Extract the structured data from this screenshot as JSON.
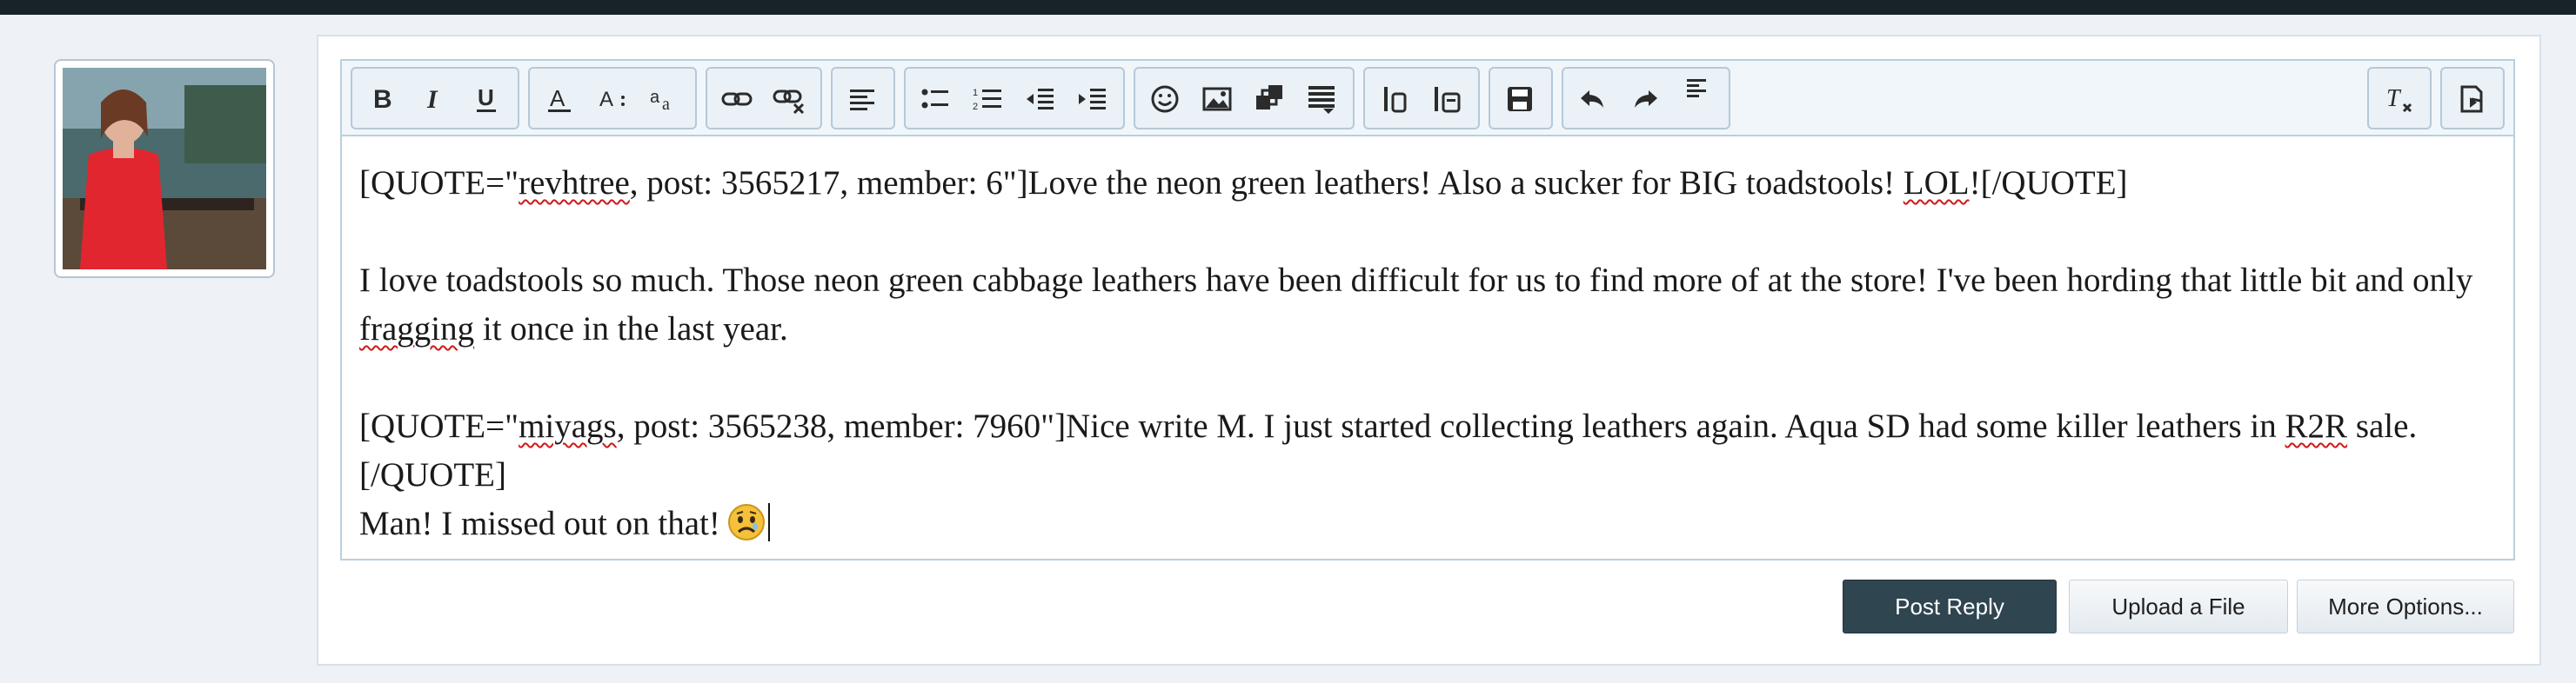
{
  "icons": {
    "bold": "bold-icon",
    "italic": "italic-icon",
    "underline": "underline-icon",
    "font_color": "font-color-icon",
    "font_size": "font-size-icon",
    "font_family": "font-family-icon",
    "link": "link-icon",
    "unlink": "unlink-icon",
    "align": "align-left-icon",
    "bullets": "bulleted-list-icon",
    "numbers": "numbered-list-icon",
    "outdent": "outdent-icon",
    "indent": "indent-icon",
    "smilies": "smilie-icon",
    "image": "image-icon",
    "media": "media-icon",
    "quote": "insert-quote-icon",
    "table1": "table-icon",
    "table2": "code-icon",
    "drafts": "save-draft-icon",
    "undo": "undo-icon",
    "redo": "redo-icon",
    "more": "more-options-icon",
    "remove_format": "remove-format-icon",
    "toggle_bbcode": "toggle-bbcode-icon"
  },
  "editor": {
    "line1_pre": "[QUOTE=\"",
    "line1_user": "revhtree",
    "line1_post": ", post: 3565217, member: 6\"]Love the neon green leathers! Also a sucker for BIG toadstools! ",
    "line1_lol": "LOL",
    "line1_end": "![/QUOTE]",
    "line2_pre": "I love toadstools so much. Those neon green cabbage leathers have been difficult for us to find more of at the store! I've been hording that little bit and only ",
    "line2_word": "fragging",
    "line2_post": " it once in the last year.",
    "line3_pre": "[QUOTE=\"",
    "line3_user": "miyags",
    "line3_mid": ", post: 3565238, member: 7960\"]Nice write M. I just started collecting leathers again. Aqua SD had some killer leathers in ",
    "line3_r2r": "R2R",
    "line3_end": " sale.[/QUOTE]",
    "line4": "Man! I missed out on that!",
    "emoji": "sad-face-emoji"
  },
  "actions": {
    "post_reply": "Post Reply",
    "upload": "Upload a File",
    "more": "More Options..."
  },
  "colors": {
    "primary_button": "#2f4550",
    "toolbar_bg": "#f1f6fa",
    "spellcheck": "#d01818"
  }
}
